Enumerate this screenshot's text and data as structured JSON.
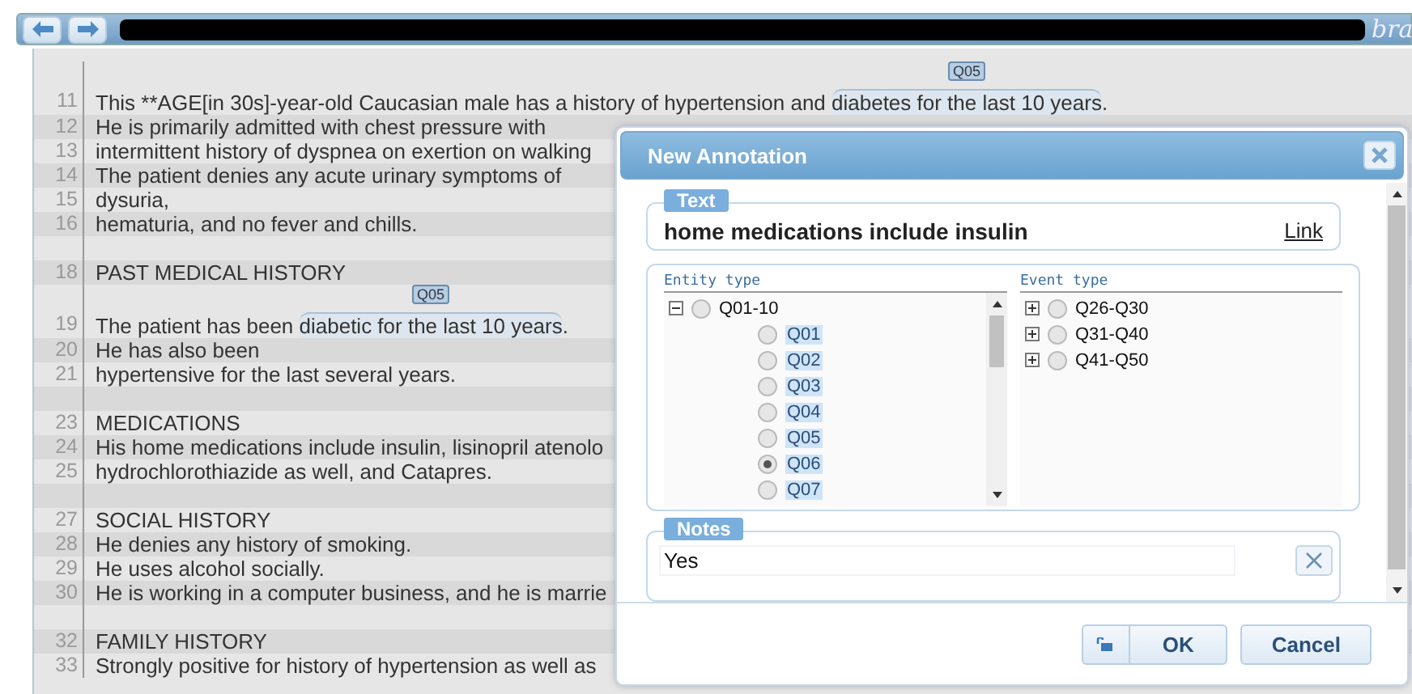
{
  "toolbar": {
    "logo_text": "bra"
  },
  "document": {
    "lines": [
      {
        "kind": "text",
        "number": "11",
        "segments": [
          {
            "text": "This **AGE[in 30s]-year-old Caucasian male has a history of hypertension and "
          },
          {
            "text": "diabetes for the last 10 years",
            "label": "Q05"
          },
          {
            "text": "."
          }
        ]
      },
      {
        "kind": "text",
        "number": "12",
        "segments": [
          {
            "text": "He is primarily admitted with chest pressure with"
          }
        ]
      },
      {
        "kind": "text",
        "number": "13",
        "segments": [
          {
            "text": "intermittent history of dyspnea on exertion on walking"
          }
        ]
      },
      {
        "kind": "text",
        "number": "14",
        "segments": [
          {
            "text": "The patient denies any acute urinary symptoms of"
          }
        ]
      },
      {
        "kind": "text",
        "number": "15",
        "segments": [
          {
            "text": "dysuria,"
          }
        ]
      },
      {
        "kind": "text",
        "number": "16",
        "segments": [
          {
            "text": "hematuria, and no fever and chills."
          }
        ]
      },
      {
        "kind": "blank"
      },
      {
        "kind": "text",
        "number": "18",
        "segments": [
          {
            "text": "PAST MEDICAL HISTORY"
          }
        ]
      },
      {
        "kind": "text",
        "number": "19",
        "segments": [
          {
            "text": "The patient has been "
          },
          {
            "text": "diabetic for the last 10 years",
            "label": "Q05"
          },
          {
            "text": "."
          }
        ]
      },
      {
        "kind": "text",
        "number": "20",
        "segments": [
          {
            "text": "He has also been"
          }
        ]
      },
      {
        "kind": "text",
        "number": "21",
        "segments": [
          {
            "text": "hypertensive for the last several years."
          }
        ]
      },
      {
        "kind": "blank"
      },
      {
        "kind": "text",
        "number": "23",
        "segments": [
          {
            "text": "MEDICATIONS"
          }
        ]
      },
      {
        "kind": "text",
        "number": "24",
        "segments": [
          {
            "text": "His home medications include insulin, lisinopril atenolo"
          }
        ]
      },
      {
        "kind": "text",
        "number": "25",
        "segments": [
          {
            "text": "hydrochlorothiazide as well, and Catapres."
          }
        ]
      },
      {
        "kind": "blank"
      },
      {
        "kind": "text",
        "number": "27",
        "segments": [
          {
            "text": "SOCIAL HISTORY"
          }
        ]
      },
      {
        "kind": "text",
        "number": "28",
        "segments": [
          {
            "text": "He denies any history of smoking."
          }
        ]
      },
      {
        "kind": "text",
        "number": "29",
        "segments": [
          {
            "text": "He uses alcohol socially."
          }
        ]
      },
      {
        "kind": "text",
        "number": "30",
        "segments": [
          {
            "text": "He is working in a computer business, and he is marrie"
          }
        ]
      },
      {
        "kind": "blank"
      },
      {
        "kind": "text",
        "number": "32",
        "segments": [
          {
            "text": "FAMILY HISTORY"
          }
        ]
      },
      {
        "kind": "text",
        "number": "33",
        "segments": [
          {
            "text": "Strongly positive for history of hypertension as well as"
          }
        ]
      }
    ]
  },
  "dialog": {
    "title": "New Annotation",
    "text_section": {
      "legend": "Text",
      "value": "home medications include insulin",
      "link": "Link"
    },
    "entity_type": {
      "heading": "Entity type",
      "nodes": [
        {
          "label": "Q01-10",
          "expanded": true,
          "selected": false,
          "children": [
            {
              "label": "Q01",
              "selected": false
            },
            {
              "label": "Q02",
              "selected": false
            },
            {
              "label": "Q03",
              "selected": false
            },
            {
              "label": "Q04",
              "selected": false
            },
            {
              "label": "Q05",
              "selected": false
            },
            {
              "label": "Q06",
              "selected": true
            },
            {
              "label": "Q07",
              "selected": false
            }
          ]
        }
      ]
    },
    "event_type": {
      "heading": "Event type",
      "nodes": [
        {
          "label": "Q26-Q30",
          "expanded": false,
          "selected": false
        },
        {
          "label": "Q31-Q40",
          "expanded": false,
          "selected": false
        },
        {
          "label": "Q41-Q50",
          "expanded": false,
          "selected": false
        }
      ]
    },
    "notes": {
      "legend": "Notes",
      "value": "Yes"
    },
    "buttons": [
      {
        "label": "OK",
        "kind": "primary"
      },
      {
        "label": "Cancel",
        "kind": "secondary"
      }
    ]
  }
}
